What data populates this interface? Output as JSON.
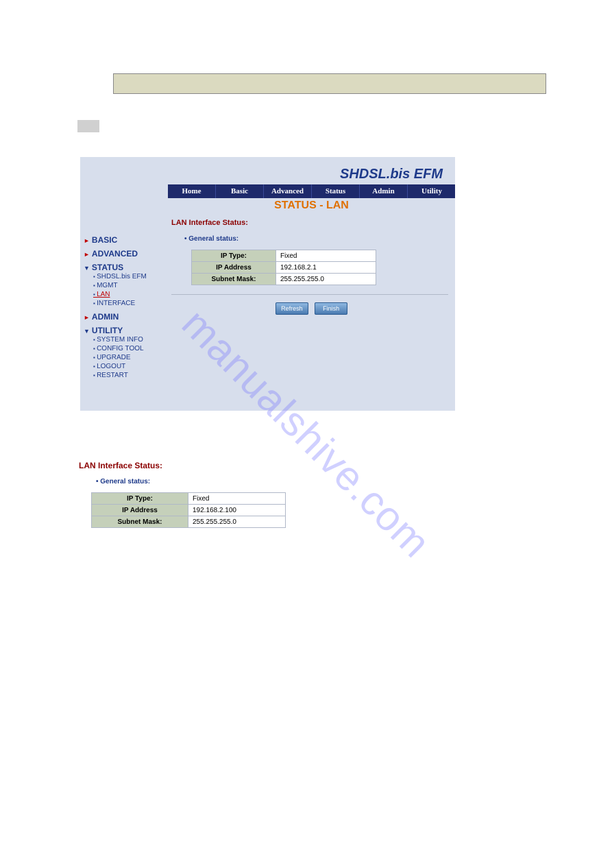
{
  "brand": "SHDSL.bis EFM",
  "nav": {
    "home": "Home",
    "basic": "Basic",
    "advanced": "Advanced",
    "status": "Status",
    "admin": "Admin",
    "utility": "Utility"
  },
  "page_title": "STATUS - LAN",
  "section_title": "LAN Interface Status:",
  "general_status_label": "General status:",
  "table1": {
    "rows": [
      {
        "label": "IP Type:",
        "value": "Fixed"
      },
      {
        "label": "IP Address",
        "value": "192.168.2.1"
      },
      {
        "label": "Subnet Mask:",
        "value": "255.255.255.0"
      }
    ]
  },
  "buttons": {
    "refresh": "Refresh",
    "finish": "Finish"
  },
  "sidebar": {
    "basic": "BASIC",
    "advanced": "ADVANCED",
    "status": "STATUS",
    "status_items": [
      "SHDSL.bis EFM",
      "MGMT",
      "LAN",
      "INTERFACE"
    ],
    "admin": "ADMIN",
    "utility": "UTILITY",
    "utility_items": [
      "SYSTEM INFO",
      "CONFIG TOOL",
      "UPGRADE",
      "LOGOUT",
      "RESTART"
    ]
  },
  "lower": {
    "section_title": "LAN Interface Status:",
    "general": "General status:",
    "rows": [
      {
        "label": "IP Type:",
        "value": "Fixed"
      },
      {
        "label": "IP Address",
        "value": "192.168.2.100"
      },
      {
        "label": "Subnet Mask:",
        "value": "255.255.255.0"
      }
    ]
  },
  "watermark": "manualshive.com"
}
